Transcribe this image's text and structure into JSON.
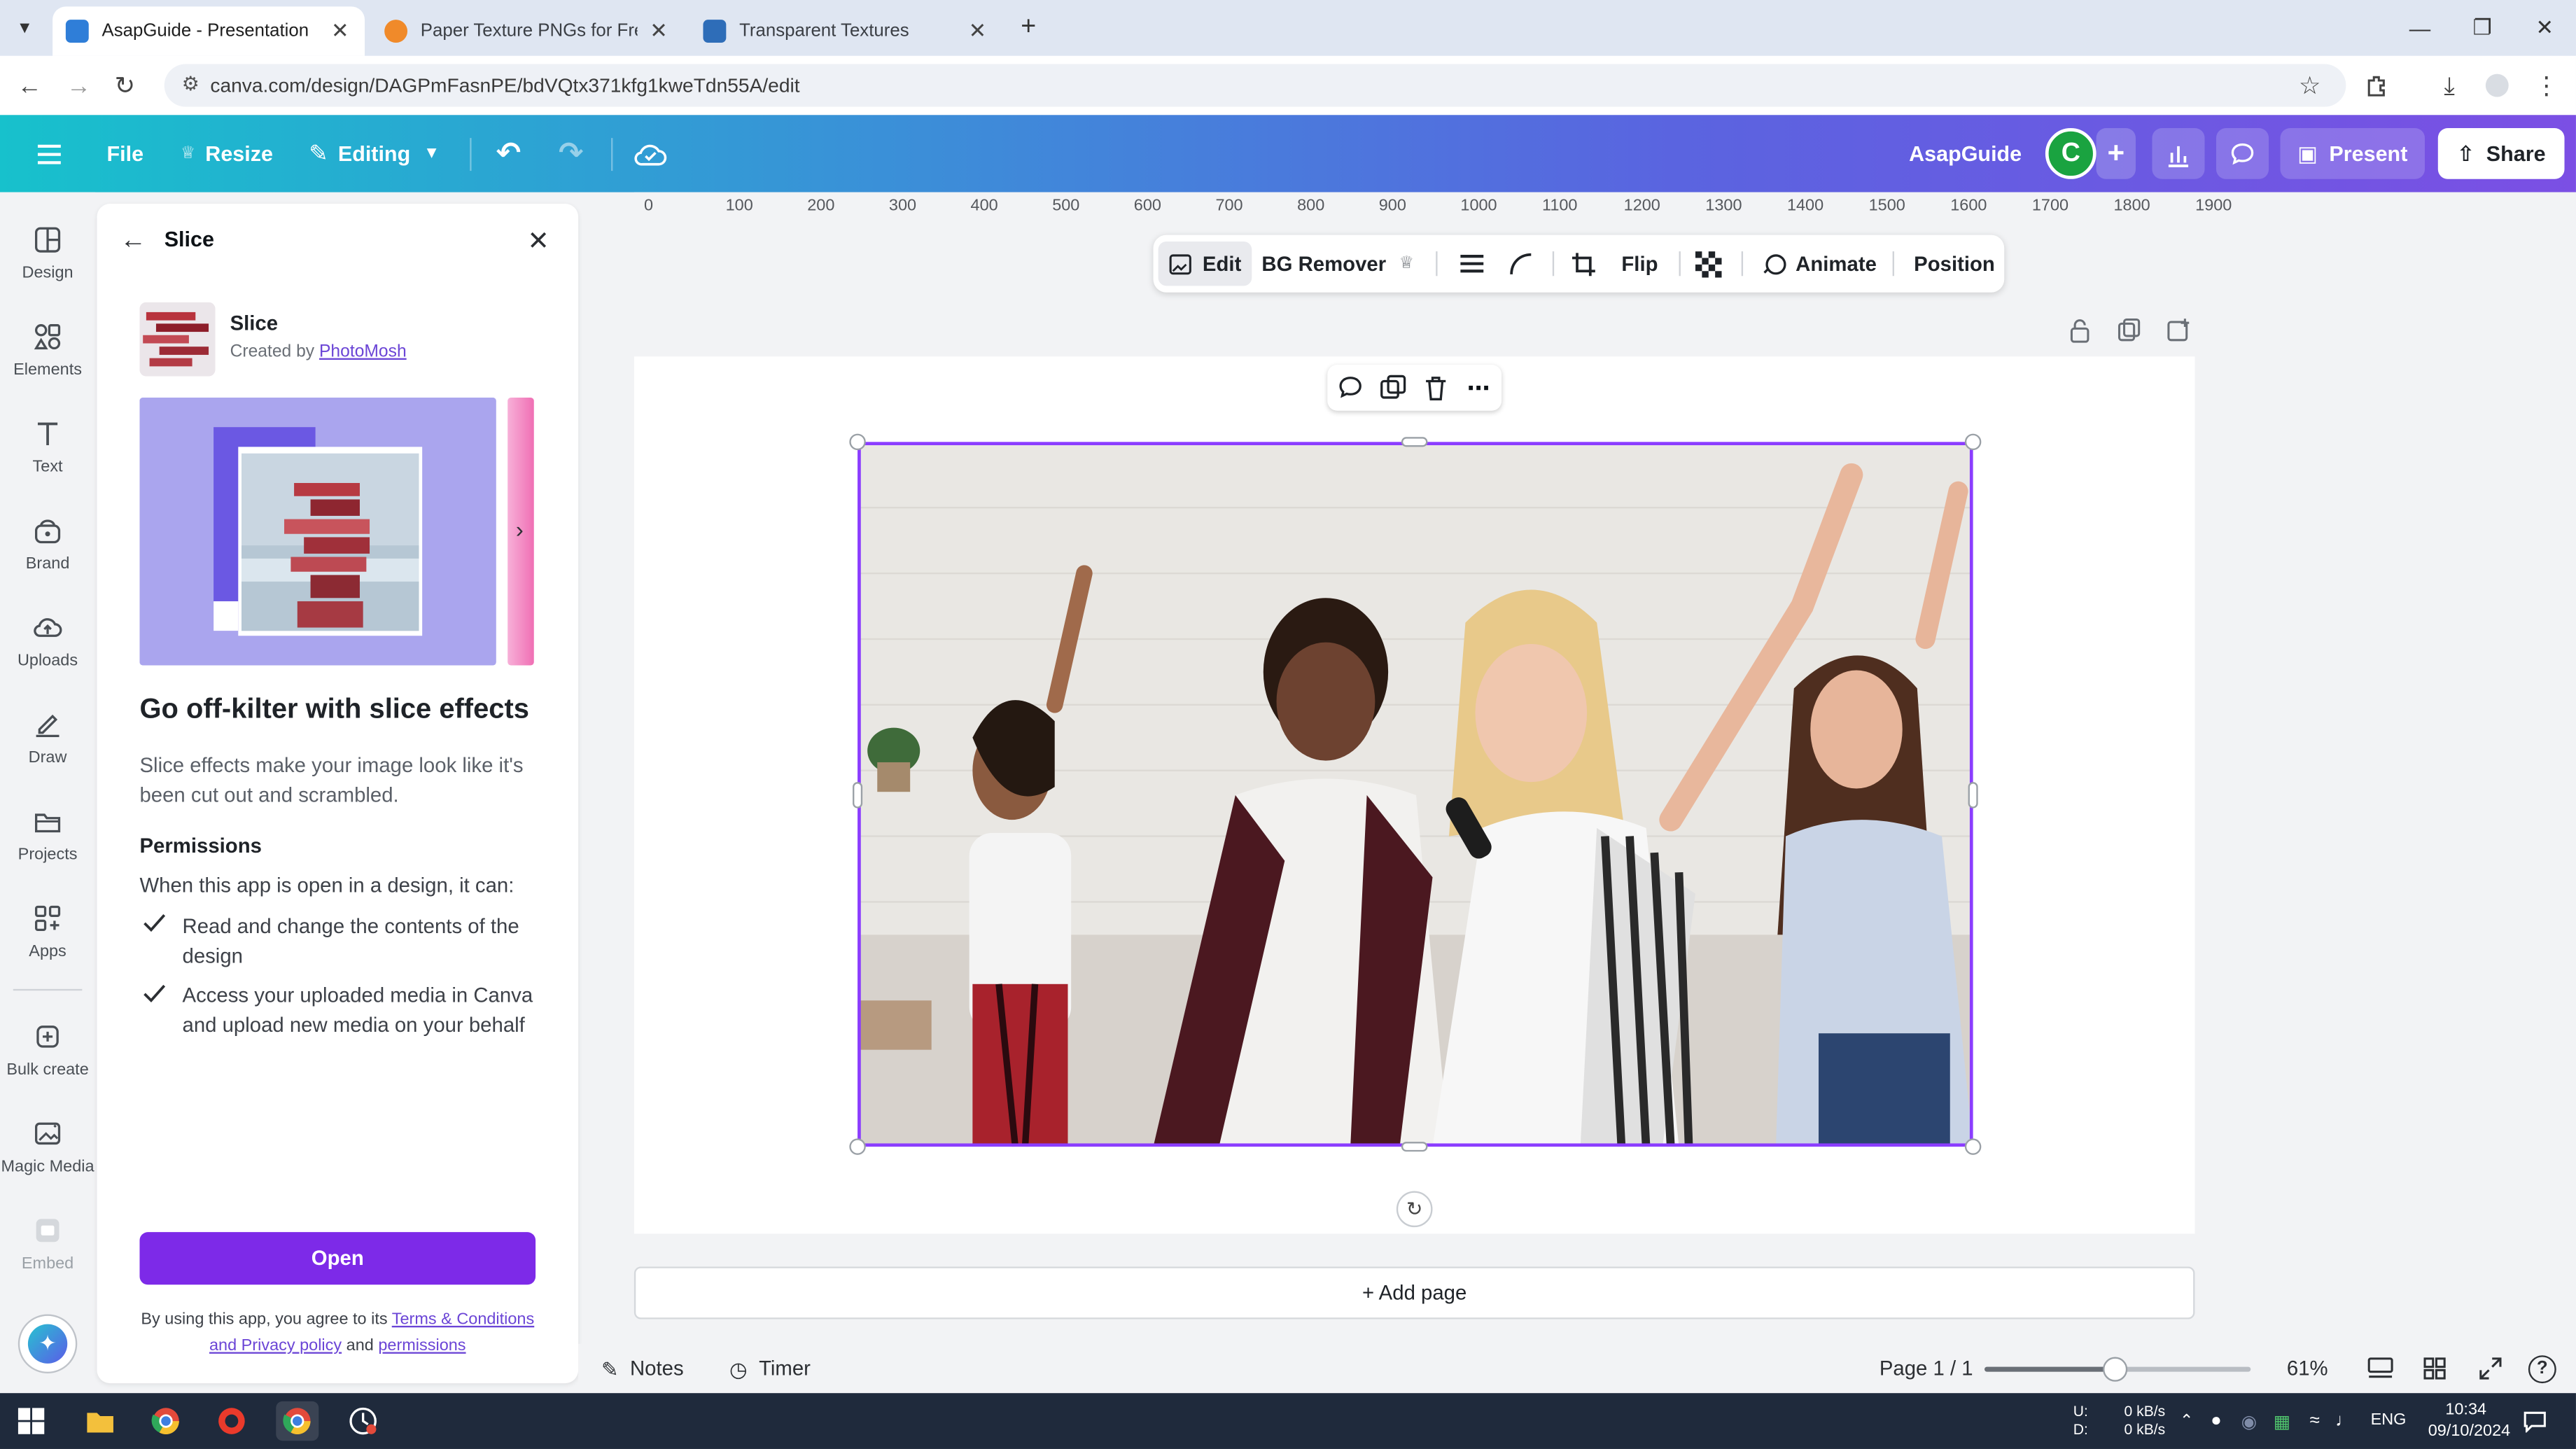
{
  "browser": {
    "tabs": [
      {
        "title": "AsapGuide - Presentation",
        "active": true
      },
      {
        "title": "Paper Texture PNGs for Free Do",
        "active": false
      },
      {
        "title": "Transparent Textures",
        "active": false
      }
    ],
    "url": "canva.com/design/DAGPmFasnPE/bdVQtx371kfg1kweTdn55A/edit"
  },
  "header": {
    "file_label": "File",
    "resize_label": "Resize",
    "editing_label": "Editing",
    "team_name": "AsapGuide",
    "avatar_letter": "C",
    "present_label": "Present",
    "share_label": "Share"
  },
  "rail": {
    "items": [
      {
        "label": "Design",
        "icon": "design-icon"
      },
      {
        "label": "Elements",
        "icon": "elements-icon"
      },
      {
        "label": "Text",
        "icon": "text-icon"
      },
      {
        "label": "Brand",
        "icon": "brand-icon"
      },
      {
        "label": "Uploads",
        "icon": "uploads-icon"
      },
      {
        "label": "Draw",
        "icon": "draw-icon"
      },
      {
        "label": "Projects",
        "icon": "projects-icon"
      },
      {
        "label": "Apps",
        "icon": "apps-icon"
      },
      {
        "label": "Bulk create",
        "icon": "bulk-create-icon"
      },
      {
        "label": "Magic Media",
        "icon": "magic-media-icon"
      },
      {
        "label": "Embed",
        "icon": "embed-icon"
      }
    ]
  },
  "panel": {
    "title": "Slice",
    "app_name": "Slice",
    "created_by_prefix": "Created by",
    "creator": "PhotoMosh",
    "headline": "Go off-kilter with slice effects",
    "description": "Slice effects make your image look like it's been cut out and scrambled.",
    "permissions_heading": "Permissions",
    "permissions_intro": "When this app is open in a design, it can:",
    "permissions": [
      "Read and change the contents of the design",
      "Access your uploaded media in Canva and upload new media on your behalf"
    ],
    "open_button": "Open",
    "footer_prefix": "By using this app, you agree to its",
    "footer_terms": "Terms & Conditions and Privacy policy",
    "footer_and": "and",
    "footer_permissions": "permissions"
  },
  "ruler": {
    "ticks": [
      "0",
      "100",
      "200",
      "300",
      "400",
      "500",
      "600",
      "700",
      "800",
      "900",
      "1000",
      "1100",
      "1200",
      "1300",
      "1400",
      "1500",
      "1600",
      "1700",
      "1800",
      "1900"
    ]
  },
  "context_toolbar": {
    "edit_label": "Edit",
    "bg_remover_label": "BG Remover",
    "flip_label": "Flip",
    "animate_label": "Animate",
    "position_label": "Position"
  },
  "canvas": {
    "add_page_label": "+ Add page"
  },
  "bottombar": {
    "notes_label": "Notes",
    "timer_label": "Timer",
    "page_indicator": "Page 1 / 1",
    "zoom_percent": "61%",
    "zoom_level": 0.61
  },
  "taskbar": {
    "net_up_label": "U:",
    "net_down_label": "D:",
    "net_up": "0 kB/s",
    "net_down": "0 kB/s",
    "language": "ENG",
    "time": "10:34",
    "date": "09/10/2024"
  },
  "colors": {
    "accent": "#8b3dff",
    "header_start": "#17c1cc",
    "header_end": "#7b4fe4",
    "avatar": "#1aa340"
  }
}
